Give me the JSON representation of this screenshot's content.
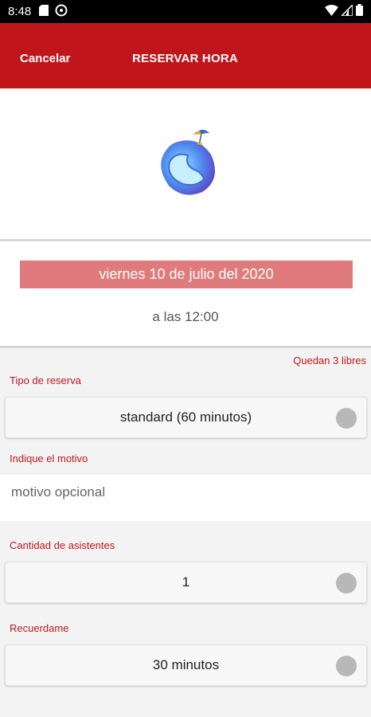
{
  "status_bar": {
    "time": "8:48",
    "icons": [
      "sd-card-icon",
      "sync-icon",
      "wifi-icon",
      "signal-icon",
      "battery-icon"
    ]
  },
  "header": {
    "cancel_label": "Cancelar",
    "title": "RESERVAR HORA",
    "background_color": "#c0161b"
  },
  "booking": {
    "date": "viernes 10 de julio del 2020",
    "time": "a las 12:00",
    "remaining": "Quedan 3 libres"
  },
  "form": {
    "tipo_label": "Tipo de reserva",
    "tipo_value": "standard (60 minutos)",
    "motivo_label": "Indique el motivo",
    "motivo_placeholder": "motivo opcional",
    "asistentes_label": "Cantidad de asistentes",
    "asistentes_value": "1",
    "recuerdame_label": "Recuerdame",
    "recuerdame_value": "30 minutos"
  }
}
